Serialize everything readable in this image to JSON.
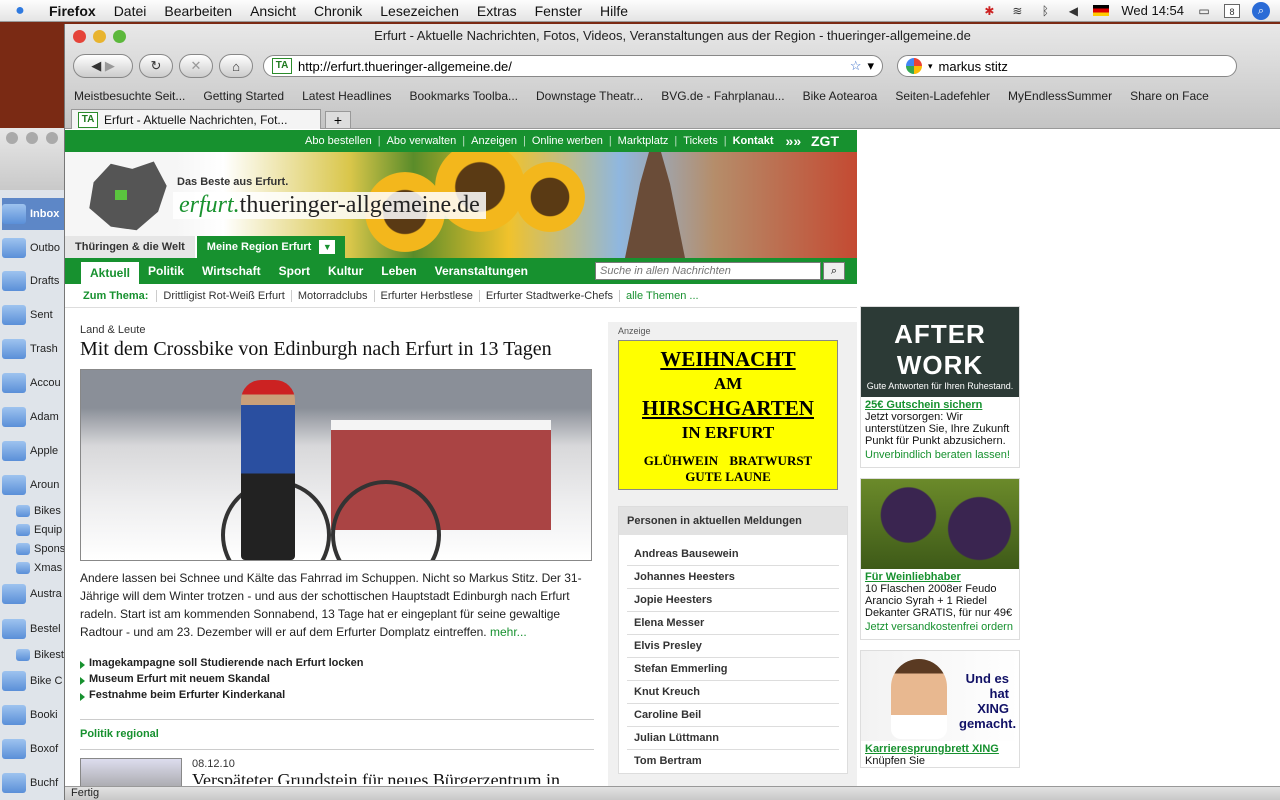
{
  "menubar": {
    "app": "Firefox",
    "items": [
      "Datei",
      "Bearbeiten",
      "Ansicht",
      "Chronik",
      "Lesezeichen",
      "Extras",
      "Fenster",
      "Hilfe"
    ],
    "clock": "Wed 14:54",
    "calendar_day": "8"
  },
  "mail": {
    "items": [
      "Inbox",
      "Outbo",
      "Drafts",
      "Sent",
      "Trash",
      "Accou",
      "Adam",
      "Apple",
      "Aroun"
    ],
    "subitems": [
      "Bikes",
      "Equip",
      "Spons",
      "Xmas"
    ],
    "more": [
      "Austra",
      "Bestel"
    ],
    "subitems2": [
      "Bikest"
    ],
    "more2": [
      "Bike C",
      "Booki",
      "Boxof",
      "Buchf"
    ]
  },
  "browser": {
    "window_title": "Erfurt - Aktuelle Nachrichten, Fotos, Videos, Veranstaltungen aus der Region - thueringer-allgemeine.de",
    "url": "http://erfurt.thueringer-allgemeine.de/",
    "site_badge": "TA",
    "search_value": "markus stitz",
    "bookmarks": [
      "Meistbesuchte Seit...",
      "Getting Started",
      "Latest Headlines",
      "Bookmarks Toolba...",
      "Downstage Theatr...",
      "BVG.de - Fahrplanau...",
      "Bike Aotearoa",
      "Seiten-Ladefehler",
      "MyEndlessSummer",
      "Share on Face"
    ],
    "tab_title": "Erfurt - Aktuelle Nachrichten, Fot...",
    "new_tab": "+",
    "status": "Fertig"
  },
  "site": {
    "topnav": [
      "Abo bestellen",
      "Abo verwalten",
      "Anzeigen",
      "Online werben",
      "Marktplatz",
      "Tickets",
      "Kontakt"
    ],
    "zgt": "ZGT",
    "claim": "Das Beste aus Erfurt.",
    "logo_prefix": "erfurt.",
    "logo_main": "thueringer-allgemeine.de",
    "region_tabs": [
      "Thüringen & die Welt",
      "Meine Region Erfurt"
    ],
    "mainnav": [
      "Aktuell",
      "Politik",
      "Wirtschaft",
      "Sport",
      "Kultur",
      "Leben",
      "Veranstaltungen"
    ],
    "search_placeholder": "Suche in allen Nachrichten",
    "thema_label": "Zum Thema:",
    "themes": [
      "Drittligist Rot-Weiß Erfurt",
      "Motorradclubs",
      "Erfurter Herbstlese",
      "Erfurter Stadtwerke-Chefs"
    ],
    "themes_more": "alle Themen ...",
    "article": {
      "kicker": "Land & Leute",
      "headline": "Mit dem Crossbike von Edinburgh nach Erfurt in 13 Tagen",
      "teaser": "Andere lassen bei Schnee und Kälte das Fahrrad im Schuppen. Nicht so Markus Stitz. Der 31-Jährige will dem Winter trotzen - und aus der schottischen Hauptstadt Edinburgh nach Erfurt radeln. Start ist am kommenden Sonnabend, 13 Tage hat er eingeplant für seine gewaltige Radtour - und am 23. Dezember will er auf dem Erfurter Domplatz eintreffen.",
      "more": "mehr..."
    },
    "bullets": [
      "Imagekampagne soll Studierende nach Erfurt locken",
      "Museum Erfurt mit neuem Skandal",
      "Festnahme beim Erfurter Kinderkanal"
    ],
    "section": "Politik regional",
    "next_date": "08.12.10",
    "next_headline": "Verspäteter Grundstein für neues Bürgerzentrum in"
  },
  "right": {
    "anzeige": "Anzeige",
    "ad_lines": [
      "WEIHNACHT",
      "AM",
      "HIRSCHGARTEN",
      "IN ERFURT",
      "GLÜHWEIN  BRATWURST",
      "GUTE LAUNE"
    ],
    "persons_title": "Personen in aktuellen Meldungen",
    "persons": [
      "Andreas Bausewein",
      "Johannes Heesters",
      "Jopie Heesters",
      "Elena Messer",
      "Elvis Presley",
      "Stefan Emmerling",
      "Knut Kreuch",
      "Caroline Beil",
      "Julian Lüttmann",
      "Tom Bertram"
    ]
  },
  "ads": [
    {
      "img_big": "AFTER WORK",
      "img_sub": "Gute Antworten für Ihren Ruhestand.",
      "head": "25€ Gutschein sichern",
      "text": "Jetzt vorsorgen: Wir unterstützen Sie, Ihre Zukunft Punkt für Punkt abzusichern.",
      "link": "Unverbindlich beraten lassen!"
    },
    {
      "head": "Für Weinliebhaber",
      "text": "10 Flaschen 2008er Feudo Arancio Syrah + 1 Riedel Dekanter GRATIS, für nur 49€",
      "link": "Jetzt versandkostenfrei ordern"
    },
    {
      "img_text": "Und es hat XING gemacht.",
      "head": "Karrieresprungbrett XING",
      "text": "Knüpfen Sie"
    }
  ]
}
